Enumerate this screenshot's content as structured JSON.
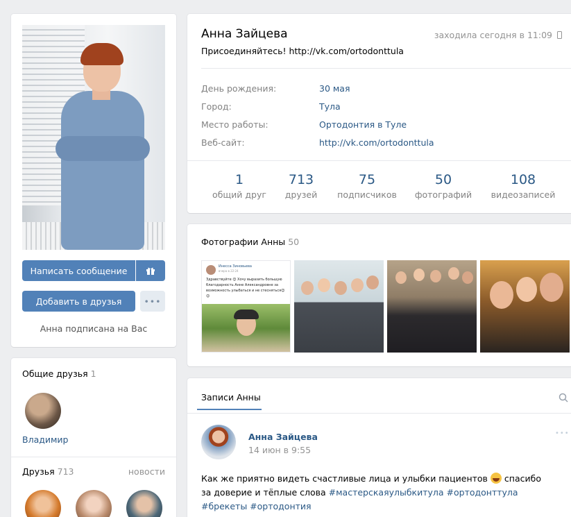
{
  "profile": {
    "name": "Анна Зайцева",
    "last_seen": "заходила сегодня в 11:09",
    "status": "Присоединяйтесь! http://vk.com/ortodonttula",
    "info": [
      {
        "label": "День рождения:",
        "value": "30 мая"
      },
      {
        "label": "Город:",
        "value": "Тула"
      },
      {
        "label": "Место работы:",
        "value": "Ортодонтия в Туле"
      },
      {
        "label": "Веб-сайт:",
        "value": "http://vk.com/ortodonttula"
      }
    ],
    "counters": [
      {
        "num": "1",
        "label": "общий друг"
      },
      {
        "num": "713",
        "label": "друзей"
      },
      {
        "num": "75",
        "label": "подписчиков"
      },
      {
        "num": "50",
        "label": "фотографий"
      },
      {
        "num": "108",
        "label": "видеозаписей"
      }
    ]
  },
  "actions": {
    "message": "Написать сообщение",
    "gift_icon": "gift-icon",
    "add_friend": "Добавить в друзья",
    "more": "•••",
    "subscribed_note": "Анна подписана на Вас"
  },
  "mutual_friends": {
    "title": "Общие друзья",
    "count": "1",
    "friend_name": "Владимир"
  },
  "friends": {
    "title": "Друзья",
    "count": "713",
    "news_link": "новости"
  },
  "photos": {
    "title": "Фотографии Анны",
    "count": "50",
    "thumb1": {
      "author": "Инесса Зиновьева",
      "date": "вчера в 22:24",
      "text": "Здравствуйте 😊 Хочу выразить большую благодарность Анне Александровне за возможность улыбаться и не стесняться😊😊"
    }
  },
  "wall": {
    "tab": "Записи Анны",
    "search_icon": "search-icon",
    "post": {
      "author": "Анна Зайцева",
      "date": "14 июн в 9:55",
      "menu": "•••",
      "text_before": "Как же приятно видеть счастливые лица и улыбки пациентов",
      "text_after": "спасибо за доверие и тёплые слова",
      "hashtags": "#мастерскаяулыбкитула #ортодонттула #брекеты #ортодонтия"
    }
  },
  "colors": {
    "accent": "#5181b8",
    "link": "#2a5885",
    "background": "#edeef0"
  }
}
